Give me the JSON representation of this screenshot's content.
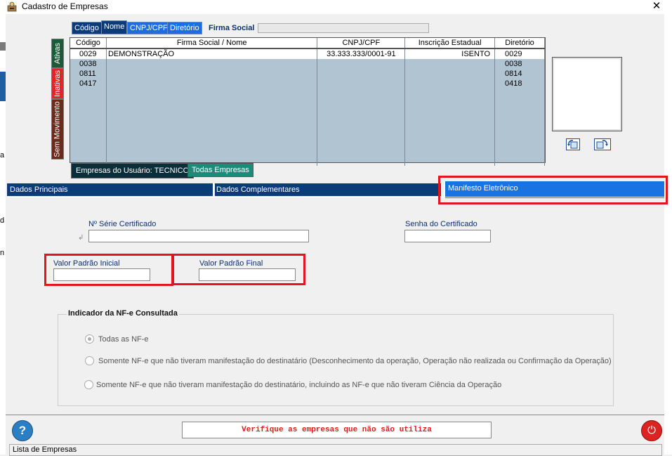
{
  "window": {
    "title": "Cadastro de Empresas",
    "close_label": "✕"
  },
  "left_strip": {
    "chars": [
      "a",
      "d",
      "n"
    ]
  },
  "search_tabs": {
    "codigo": "Código",
    "nome": "Nome",
    "cnpj": "CNPJ/CPF",
    "diretorio": "Diretório"
  },
  "firma_label": "Firma Social",
  "side_tabs": {
    "ativas": "Ativas",
    "inativas": "Inativas",
    "sem_movimento": "Sem Movimento"
  },
  "grid": {
    "columns": [
      "Código",
      "Firma Social / Nome",
      "CNPJ/CPF",
      "Inscrição Estadual",
      "Diretório"
    ],
    "rows": [
      {
        "codigo": "0029",
        "nome": "DEMONSTRAÇÃO",
        "cnpj": "33.333.333/0001-91",
        "ie": "ISENTO",
        "dir": "0029"
      },
      {
        "codigo": "0038",
        "nome": "",
        "cnpj": "",
        "ie": "",
        "dir": "0038"
      },
      {
        "codigo": "0811",
        "nome": "",
        "cnpj": "",
        "ie": "",
        "dir": "0814"
      },
      {
        "codigo": "0417",
        "nome": "",
        "cnpj": "",
        "ie": "",
        "dir": "0418"
      }
    ]
  },
  "grid_tabs": {
    "usuario": "Empresas do Usuário: TECNICO",
    "todas": "Todas Empresas"
  },
  "section_tabs": {
    "dados_principais": "Dados Principais",
    "dados_complementares": "Dados Complementares",
    "manifesto": "Manifesto Eletrônico"
  },
  "form": {
    "serie_label": "Nº Série Certificado",
    "serie_value": "",
    "senha_label": "Senha do Certificado",
    "senha_value": "",
    "vpi_label": "Valor Padrão Inicial",
    "vpi_value": "",
    "vpf_label": "Valor Padrão Final",
    "vpf_value": ""
  },
  "indicator": {
    "title": "Indicador da NF-e Consultada",
    "options": [
      "Todas as NF-e",
      "Somente NF-e  que não tiveram manifestação do destinatário (Desconhecimento da operação, Operação não realizada ou Confirmação da Operação)",
      "Somente NF-e que não tiveram manifestação do destinatário, incluindo as NF-e que não tiveram Ciência da Operação"
    ],
    "selected": 0
  },
  "footer": {
    "help": "?",
    "message": "Verifique as empresas que não são utiliza",
    "power": "⏻"
  },
  "status_bar": "Lista de Empresas",
  "colors": {
    "navy": "#0b3b78",
    "highlight": "#1a73e0",
    "annotation_red": "#e3151e",
    "grid_bg": "#b0c4d2"
  }
}
